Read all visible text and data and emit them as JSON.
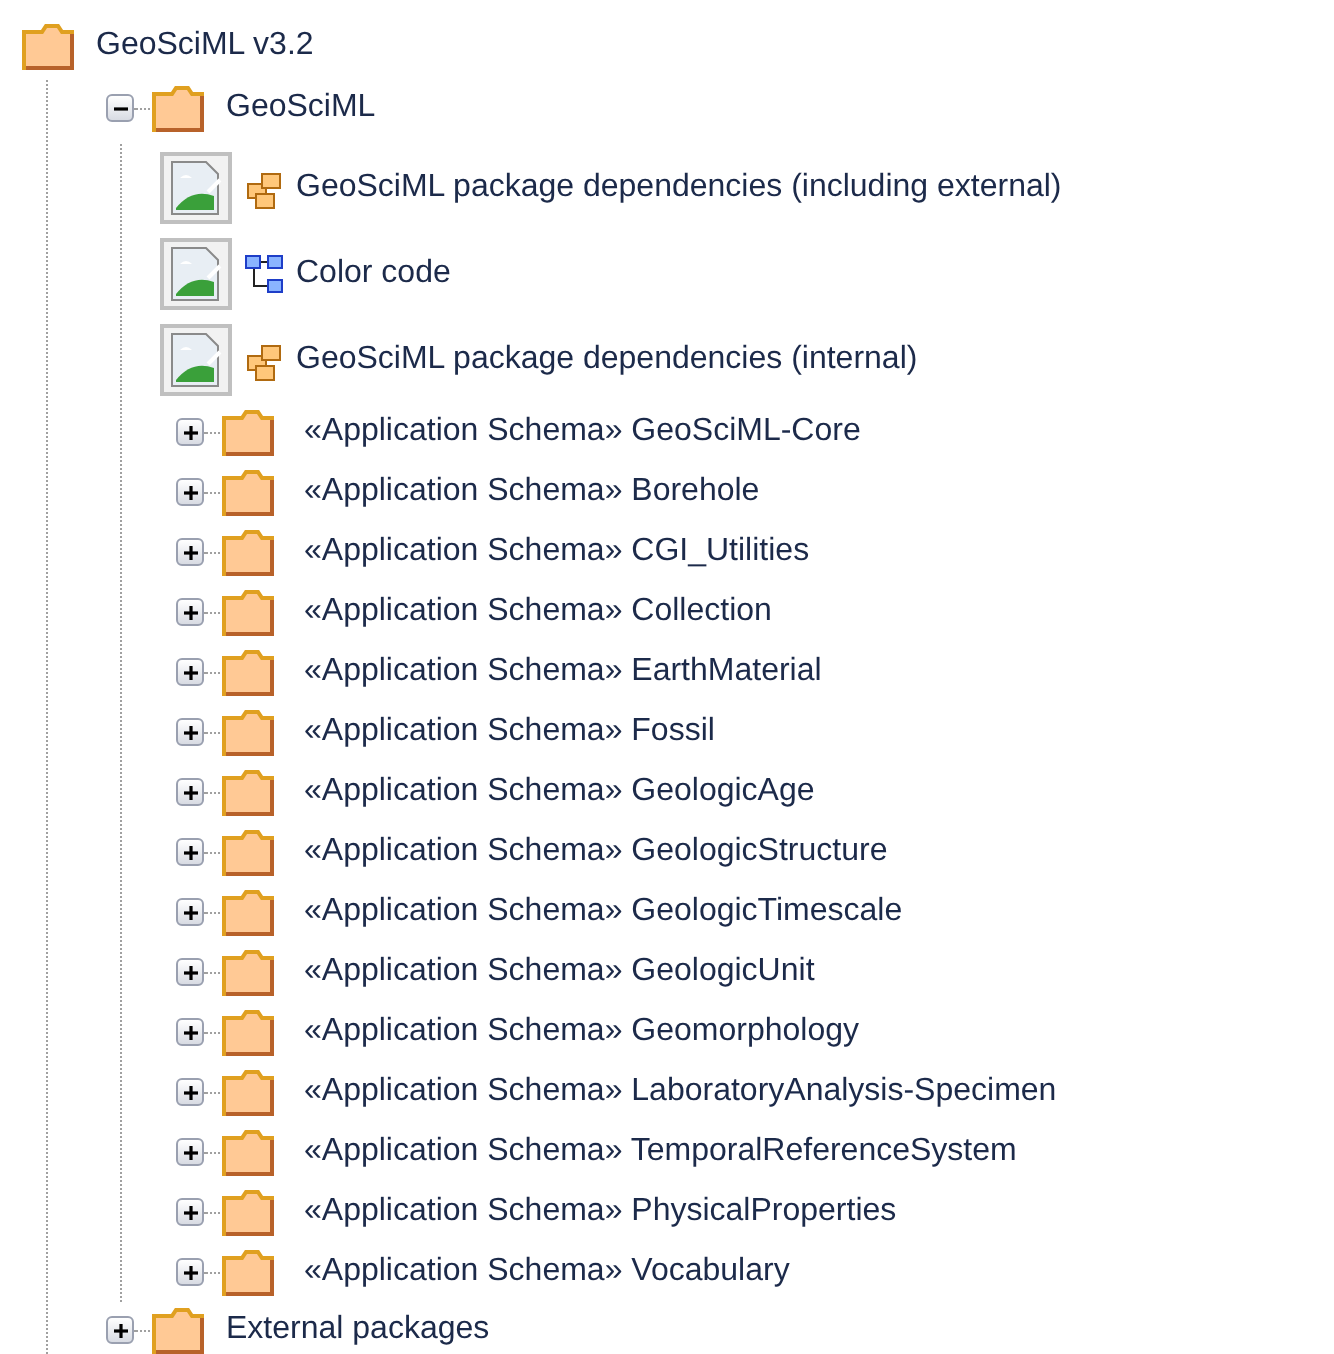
{
  "tree": {
    "kind": "package",
    "label": "GeoSciML v3.2",
    "children": [
      {
        "kind": "package",
        "label": "GeoSciML",
        "expanded": true,
        "children": [
          {
            "kind": "package-diagram",
            "label": "GeoSciML package dependencies (including external)"
          },
          {
            "kind": "class-diagram",
            "label": "Color code"
          },
          {
            "kind": "package-diagram",
            "label": "GeoSciML package dependencies (internal)"
          },
          {
            "kind": "package",
            "label": "«Application Schema» GeoSciML-Core",
            "expanded": false
          },
          {
            "kind": "package",
            "label": "«Application Schema» Borehole",
            "expanded": false
          },
          {
            "kind": "package",
            "label": "«Application Schema» CGI_Utilities",
            "expanded": false
          },
          {
            "kind": "package",
            "label": "«Application Schema» Collection",
            "expanded": false
          },
          {
            "kind": "package",
            "label": "«Application Schema» EarthMaterial",
            "expanded": false
          },
          {
            "kind": "package",
            "label": "«Application Schema» Fossil",
            "expanded": false
          },
          {
            "kind": "package",
            "label": "«Application Schema» GeologicAge",
            "expanded": false
          },
          {
            "kind": "package",
            "label": "«Application Schema» GeologicStructure",
            "expanded": false
          },
          {
            "kind": "package",
            "label": "«Application Schema» GeologicTimescale",
            "expanded": false
          },
          {
            "kind": "package",
            "label": "«Application Schema» GeologicUnit",
            "expanded": false
          },
          {
            "kind": "package",
            "label": "«Application Schema» Geomorphology",
            "expanded": false
          },
          {
            "kind": "package",
            "label": "«Application Schema» LaboratoryAnalysis-Specimen",
            "expanded": false
          },
          {
            "kind": "package",
            "label": "«Application Schema» TemporalReferenceSystem",
            "expanded": false
          },
          {
            "kind": "package",
            "label": "«Application Schema» PhysicalProperties",
            "expanded": false
          },
          {
            "kind": "package",
            "label": "«Application Schema» Vocabulary",
            "expanded": false
          }
        ]
      },
      {
        "kind": "package",
        "label": "External packages",
        "expanded": false
      }
    ]
  }
}
